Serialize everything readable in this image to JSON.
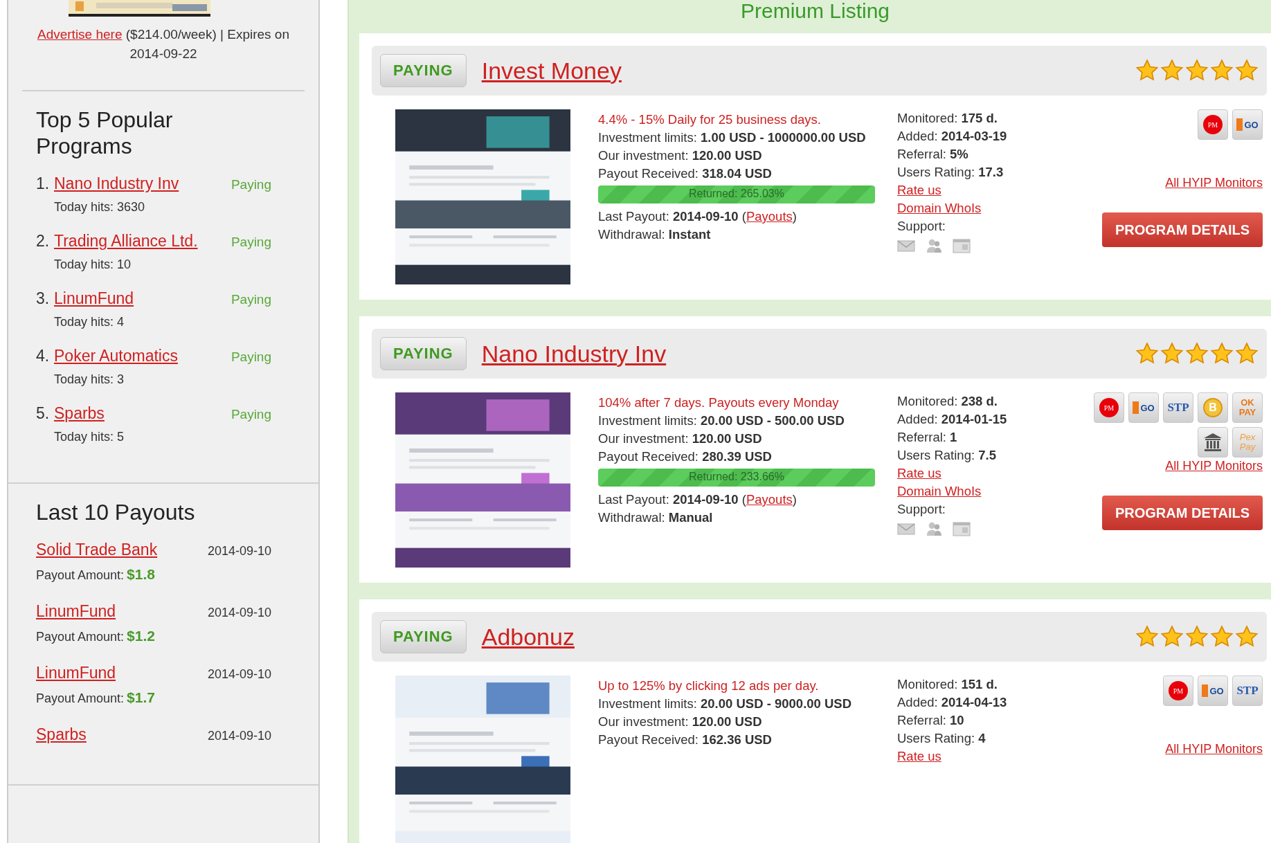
{
  "sidebar": {
    "ad": {
      "link": "Advertise here",
      "text": "($214.00/week) | Expires on 2014-09-22"
    },
    "popular": {
      "title": "Top 5 Popular Programs",
      "items": [
        {
          "rank": "1.",
          "name": "Nano Industry Inv",
          "status": "Paying",
          "hits": "Today hits: 3630"
        },
        {
          "rank": "2.",
          "name": "Trading Alliance Ltd.",
          "status": "Paying",
          "hits": "Today hits: 10"
        },
        {
          "rank": "3.",
          "name": "LinumFund",
          "status": "Paying",
          "hits": "Today hits: 4"
        },
        {
          "rank": "4.",
          "name": "Poker Automatics",
          "status": "Paying",
          "hits": "Today hits: 3"
        },
        {
          "rank": "5.",
          "name": "Sparbs",
          "status": "Paying",
          "hits": "Today hits: 5"
        }
      ]
    },
    "payouts": {
      "title": "Last 10 Payouts",
      "items": [
        {
          "name": "Solid Trade Bank",
          "date": "2014-09-10",
          "label": "Payout Amount:",
          "amount": "$1.8"
        },
        {
          "name": "LinumFund",
          "date": "2014-09-10",
          "label": "Payout Amount:",
          "amount": "$1.2"
        },
        {
          "name": "LinumFund",
          "date": "2014-09-10",
          "label": "Payout Amount:",
          "amount": "$1.7"
        },
        {
          "name": "Sparbs",
          "date": "2014-09-10"
        }
      ]
    }
  },
  "main": {
    "title": "Premium Listing",
    "listings": [
      {
        "status": "PAYING",
        "name": "Invest Money",
        "stars": 5,
        "plan": "4.4% - 15% Daily for 25 business days.",
        "details": [
          {
            "label": "Investment limits:",
            "value": "1.00 USD - 1000000.00 USD"
          },
          {
            "label": "Our investment:",
            "value": "120.00 USD"
          },
          {
            "label": "Payout Received:",
            "value": "318.04 USD"
          }
        ],
        "returned": {
          "text": "Returned: 265.03%",
          "level": 1
        },
        "last_payout": {
          "label": "Last Payout:",
          "value": "2014-09-10",
          "open": "(",
          "link": "Payouts",
          "close": ")"
        },
        "withdrawal": {
          "label": "Withdrawal:",
          "value": "Instant"
        },
        "stats": [
          {
            "label": "Monitored:",
            "value": "175 d."
          },
          {
            "label": "Added:",
            "value": "2014-03-19"
          },
          {
            "label": "Referral:",
            "value": "5%"
          },
          {
            "label": "Users Rating:",
            "value": "17.3"
          }
        ],
        "links": [
          "Rate us",
          "Domain WhoIs"
        ],
        "support": "Support:",
        "processors": [
          {
            "kind": "pm",
            "label": "PM"
          },
          {
            "kind": "egopay",
            "label": "GO"
          }
        ],
        "monitors_link": "All HYIP Monitors",
        "button": "PROGRAM DETAILS"
      },
      {
        "status": "PAYING",
        "name": "Nano Industry Inv",
        "stars": 5,
        "plan": "104% after 7 days. Payouts every Monday",
        "details": [
          {
            "label": "Investment limits:",
            "value": "20.00 USD - 500.00 USD"
          },
          {
            "label": "Our investment:",
            "value": "120.00 USD"
          },
          {
            "label": "Payout Received:",
            "value": "280.39 USD"
          }
        ],
        "returned": {
          "text": "Returned: 233.66%",
          "level": 1
        },
        "last_payout": {
          "label": "Last Payout:",
          "value": "2014-09-10",
          "open": "(",
          "link": "Payouts",
          "close": ")"
        },
        "withdrawal": {
          "label": "Withdrawal:",
          "value": "Manual"
        },
        "stats": [
          {
            "label": "Monitored:",
            "value": "238 d."
          },
          {
            "label": "Added:",
            "value": "2014-01-15"
          },
          {
            "label": "Referral:",
            "value": "1"
          },
          {
            "label": "Users Rating:",
            "value": "7.5"
          }
        ],
        "links": [
          "Rate us",
          "Domain WhoIs"
        ],
        "support": "Support:",
        "processors": [
          {
            "kind": "pm",
            "label": "PM"
          },
          {
            "kind": "egopay",
            "label": "GO"
          },
          {
            "kind": "stp",
            "label": "STP"
          },
          {
            "kind": "bitcoin",
            "label": "B"
          },
          {
            "kind": "okpay",
            "label": "OK PAY"
          },
          {
            "kind": "bank"
          },
          {
            "kind": "pexpay",
            "label": "Pex Pay"
          }
        ],
        "monitors_link": "All HYIP Monitors",
        "button": "PROGRAM DETAILS"
      },
      {
        "status": "PAYING",
        "name": "Adbonuz",
        "stars": 5,
        "plan": "Up to 125% by clicking 12 ads per day.",
        "details": [
          {
            "label": "Investment limits:",
            "value": "20.00 USD - 9000.00 USD"
          },
          {
            "label": "Our investment:",
            "value": "120.00 USD"
          },
          {
            "label": "Payout Received:",
            "value": "162.36 USD"
          }
        ],
        "stats": [
          {
            "label": "Monitored:",
            "value": "151 d."
          },
          {
            "label": "Added:",
            "value": "2014-04-13"
          },
          {
            "label": "Referral:",
            "value": "10"
          },
          {
            "label": "Users Rating:",
            "value": "4"
          }
        ],
        "links": [
          "Rate us"
        ],
        "processors": [
          {
            "kind": "pm",
            "label": "PM"
          },
          {
            "kind": "egopay",
            "label": "GO"
          },
          {
            "kind": "stp",
            "label": "STP"
          }
        ],
        "monitors_link": "All HYIP Monitors"
      }
    ]
  }
}
